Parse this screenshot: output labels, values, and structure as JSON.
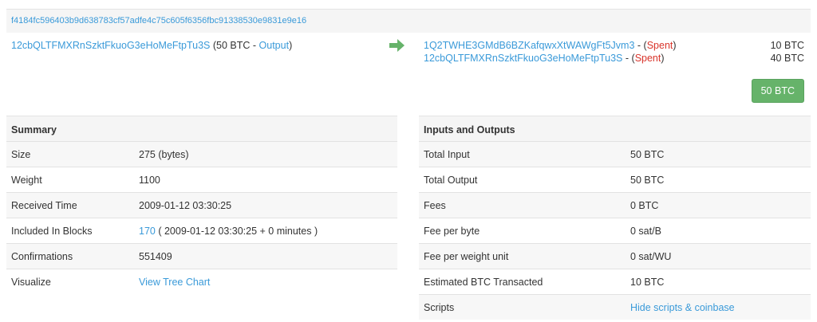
{
  "transaction": {
    "hash": "f4184fc596403b9d638783cf57adfe4c75c605f6356fbc91338530e9831e9e16",
    "input": {
      "address": "12cbQLTFMXRnSzktFkuoG3eHoMeFtpTu3S",
      "amount_prefix": " (50 BTC - ",
      "output_link": "Output",
      "suffix": ")"
    },
    "outputs": [
      {
        "address": "1Q2TWHE3GMdB6BZKafqwxXtWAWgFt5Jvm3",
        "sep": " - (",
        "status": "Spent",
        "close": ")",
        "amount": "10 BTC"
      },
      {
        "address": "12cbQLTFMXRnSzktFkuoG3eHoMeFtpTu3S",
        "sep": " - (",
        "status": "Spent",
        "close": ")",
        "amount": "40 BTC"
      }
    ],
    "total_button": "50 BTC"
  },
  "summary": {
    "title": "Summary",
    "size_label": "Size",
    "size_value": "275 (bytes)",
    "weight_label": "Weight",
    "weight_value": "1100",
    "received_label": "Received Time",
    "received_value": "2009-01-12 03:30:25",
    "blocks_label": "Included In Blocks",
    "block_link": "170",
    "block_detail": " ( 2009-01-12 03:30:25 + 0 minutes )",
    "confirmations_label": "Confirmations",
    "confirmations_value": "551409",
    "visualize_label": "Visualize",
    "visualize_link": "View Tree Chart"
  },
  "io": {
    "title": "Inputs and Outputs",
    "total_input_label": "Total Input",
    "total_input_value": "50 BTC",
    "total_output_label": "Total Output",
    "total_output_value": "50 BTC",
    "fees_label": "Fees",
    "fees_value": "0 BTC",
    "fee_byte_label": "Fee per byte",
    "fee_byte_value": "0 sat/B",
    "fee_wu_label": "Fee per weight unit",
    "fee_wu_value": "0 sat/WU",
    "est_label": "Estimated BTC Transacted",
    "est_value": "10 BTC",
    "scripts_label": "Scripts",
    "scripts_link": "Hide scripts & coinbase"
  },
  "colors": {
    "link": "#3a9ad9",
    "spent": "#d9342b",
    "accent_green": "#66b36a"
  },
  "icons": {
    "flow_arrow": "right-arrow-icon"
  }
}
